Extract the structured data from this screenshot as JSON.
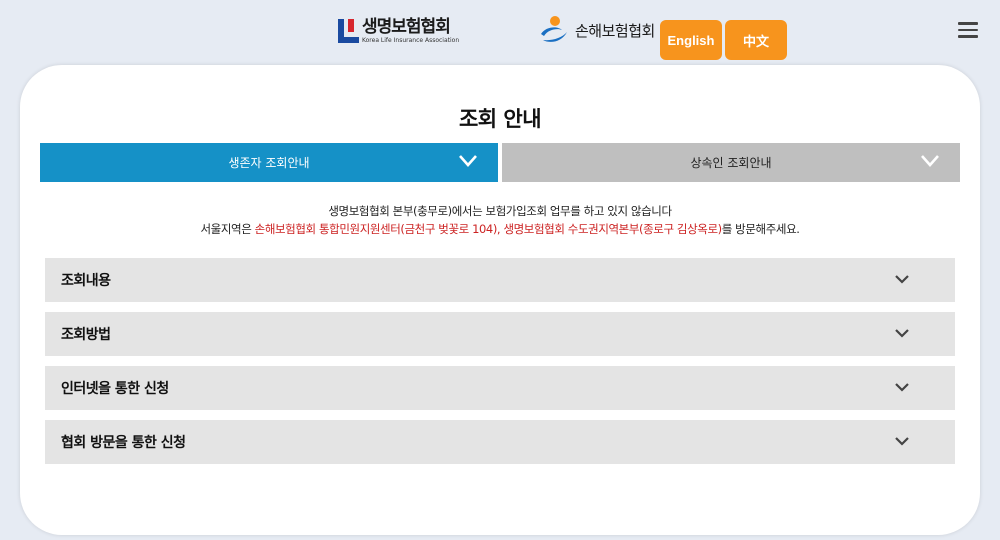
{
  "header": {
    "life_logo_ko": "생명보험협회",
    "life_logo_en": "Korea Life Insurance Association",
    "general_logo_ko": "손해보험협회",
    "english_label": "English",
    "chinese_label": "中文"
  },
  "page_title": "조회 안내",
  "tabs": [
    {
      "label": "생존자 조회안내",
      "active": true
    },
    {
      "label": "상속인 조회안내",
      "active": false
    }
  ],
  "notice": {
    "line1": "생명보험협회 본부(충무로)에서는 보험가입조회 업무를 하고 있지 않습니다",
    "line2_pre": "서울지역은 ",
    "line2_red": "손해보험협회 통합민원지원센터(금천구 벚꽃로 104), 생명보험협회 수도권지역본부(종로구 김상옥로)",
    "line2_post": "를 방문해주세요."
  },
  "accordion": [
    {
      "label": "조회내용"
    },
    {
      "label": "조회방법"
    },
    {
      "label": "인터넷을 통한 신청"
    },
    {
      "label": "협회 방문을 통한 신청"
    }
  ],
  "colors": {
    "accent_orange": "#f7941d",
    "tab_active": "#1591c7",
    "tab_inactive": "#bfbfbf",
    "notice_red": "#cc2222",
    "page_bg": "#e6ebf3"
  },
  "icons": {
    "menu": "hamburger-menu-icon",
    "expand": "chevron-down-icon"
  }
}
